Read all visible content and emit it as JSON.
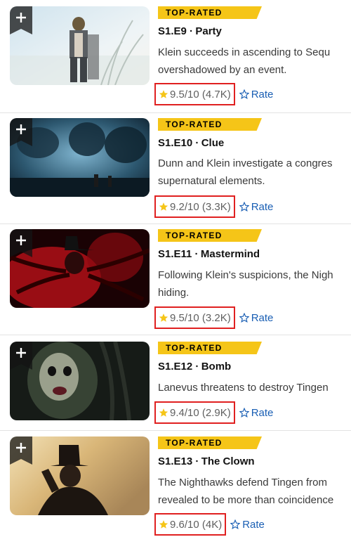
{
  "colors": {
    "badge": "#f5c518",
    "rating_border": "#e02020",
    "rate_link": "#1a5fb4",
    "star": "#f5c518"
  },
  "episodes": [
    {
      "badge": "TOP-RATED",
      "title": "S1.E9 ∙ Party",
      "description_lines": [
        "Klein succeeds in ascending to Sequ",
        "overshadowed by an event."
      ],
      "rating": "9.5/10 (4.7K)",
      "rate_label": "Rate",
      "thumbnail": "thumb-party"
    },
    {
      "badge": "TOP-RATED",
      "title": "S1.E10 ∙ Clue",
      "description_lines": [
        "Dunn and Klein investigate a congres",
        "supernatural elements."
      ],
      "rating": "9.2/10 (3.3K)",
      "rate_label": "Rate",
      "thumbnail": "thumb-clue"
    },
    {
      "badge": "TOP-RATED",
      "title": "S1.E11 ∙ Mastermind",
      "description_lines": [
        "Following Klein's suspicions, the Nigh",
        "hiding."
      ],
      "rating": "9.5/10 (3.2K)",
      "rate_label": "Rate",
      "thumbnail": "thumb-mastermind"
    },
    {
      "badge": "TOP-RATED",
      "title": "S1.E12 ∙ Bomb",
      "description_lines": [
        "Lanevus threatens to destroy Tingen"
      ],
      "rating": "9.4/10 (2.9K)",
      "rate_label": "Rate",
      "thumbnail": "thumb-bomb"
    },
    {
      "badge": "TOP-RATED",
      "title": "S1.E13 ∙ The Clown",
      "description_lines": [
        "The Nighthawks defend Tingen from",
        "revealed to be more than coincidence"
      ],
      "rating": "9.6/10 (4K)",
      "rate_label": "Rate",
      "thumbnail": "thumb-clown"
    }
  ]
}
